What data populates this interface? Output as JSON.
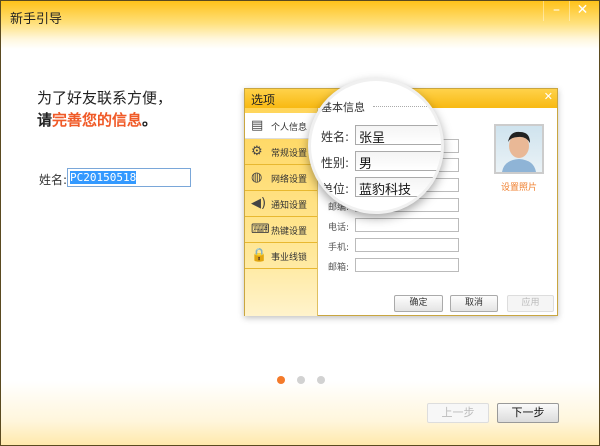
{
  "window": {
    "title": "新手引导",
    "minimize_icon": "minimize-icon",
    "close_icon": "close-icon"
  },
  "intro": {
    "line1": "为了好友联系方便，",
    "line2_prefix": "请",
    "line2_highlight": "完善您的信息",
    "line2_suffix": "。"
  },
  "name_field": {
    "label": "姓名:",
    "value": "PC20150518"
  },
  "preview": {
    "title": "选项",
    "sidebar": [
      {
        "label": "个人信息",
        "icon": "id-card-icon"
      },
      {
        "label": "常规设置",
        "icon": "gear-icon"
      },
      {
        "label": "网络设置",
        "icon": "globe-icon"
      },
      {
        "label": "通知设置",
        "icon": "speaker-icon"
      },
      {
        "label": "热键设置",
        "icon": "keyboard-icon"
      },
      {
        "label": "事业线锁",
        "icon": "lock-icon"
      }
    ],
    "section": "基本信息",
    "fields": [
      {
        "label": "姓名:",
        "value": "张呈"
      },
      {
        "label": "性别:",
        "value": "男"
      },
      {
        "label": "单位:",
        "value": "蓝豹科技"
      },
      {
        "label": "邮编:",
        "value": ""
      },
      {
        "label": "电话:",
        "value": ""
      },
      {
        "label": "手机:",
        "value": ""
      },
      {
        "label": "邮箱:",
        "value": ""
      }
    ],
    "set_photo": "设置照片",
    "buttons": {
      "ok": "确定",
      "cancel": "取消",
      "apply": "应用"
    }
  },
  "pager": {
    "pages": 3,
    "current": 1,
    "active_color": "#f47a2a"
  },
  "nav": {
    "prev": "上一步",
    "next": "下一步"
  }
}
